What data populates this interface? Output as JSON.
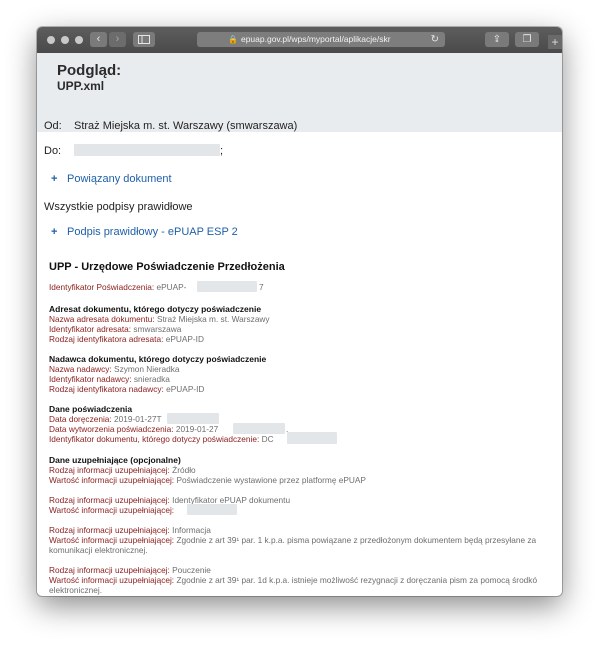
{
  "browser": {
    "url": "epuap.gov.pl/wps/myportal/aplikacje/skr",
    "back_icon": "chevron-left-icon",
    "forward_icon": "chevron-right-icon"
  },
  "preview": {
    "title": "Podgląd:",
    "file": "UPP.xml"
  },
  "meta": {
    "from_label": "Od:",
    "from_value": "Straż Miejska m. st. Warszawy (smwarszawa)",
    "to_label": "Do:",
    "to_trailing": ";"
  },
  "links": {
    "related": "Powiązany dokument",
    "signatures_status": "Wszystkie podpisy prawidłowe",
    "signature": "Podpis prawidłowy - ePUAP ESP 2"
  },
  "upp": {
    "title": "UPP - Urzędowe Poświadczenie Przedłożenia",
    "id_label": "Identyfikator Poświadczenia:",
    "id_prefix": "ePUAP-",
    "id_suffix": "7",
    "addressee": {
      "heading": "Adresat dokumentu, którego dotyczy poświadczenie",
      "name_label": "Nazwa adresata dokumentu:",
      "name_value": "Straż Miejska m. st. Warszawy",
      "id_label": "Identyfikator adresata:",
      "id_value": "smwarszawa",
      "type_label": "Rodzaj identyfikatora adresata:",
      "type_value": "ePUAP-ID"
    },
    "sender": {
      "heading": "Nadawca dokumentu, którego dotyczy poświadczenie",
      "name_label": "Nazwa nadawcy:",
      "name_value": "Szymon Nieradka",
      "id_label": "Identyfikator nadawcy:",
      "id_value": "snieradka",
      "type_label": "Rodzaj identyfikatora nadawcy:",
      "type_value": "ePUAP-ID"
    },
    "certificate": {
      "heading": "Dane poświadczenia",
      "delivery_label": "Data doręczenia:",
      "delivery_value": "2019-01-27T",
      "created_label": "Data wytworzenia poświadczenia:",
      "created_value": "2019-01-27",
      "created_suffix": ".",
      "docid_label": "Identyfikator dokumentu, którego dotyczy poświadczenie:",
      "docid_value": "DC"
    },
    "extra": {
      "heading": "Dane uzupełniające (opcjonalne)",
      "type_label": "Rodzaj informacji uzupełniającej:",
      "value_label": "Wartość informacji uzupełniającej:",
      "items": [
        {
          "type": "Źródło",
          "value": "Poświadczenie wystawione przez platformę ePUAP",
          "value_cont": ""
        },
        {
          "type": "Identyfikator ePUAP dokumentu",
          "value": "",
          "value_cont": ""
        },
        {
          "type": "Informacja",
          "value": "Zgodnie z art 39¹ par. 1 k.p.a. pisma powiązane z przedłożonym dokumentem będą przesyłane za",
          "value_cont": "komunikacji elektronicznej."
        },
        {
          "type": "Pouczenie",
          "value": "Zgodnie z art 39¹ par. 1d k.p.a. istnieje możliwość rezygnacji z doręczania pism za pomocą środkó",
          "value_cont": "elektronicznej."
        }
      ]
    }
  }
}
